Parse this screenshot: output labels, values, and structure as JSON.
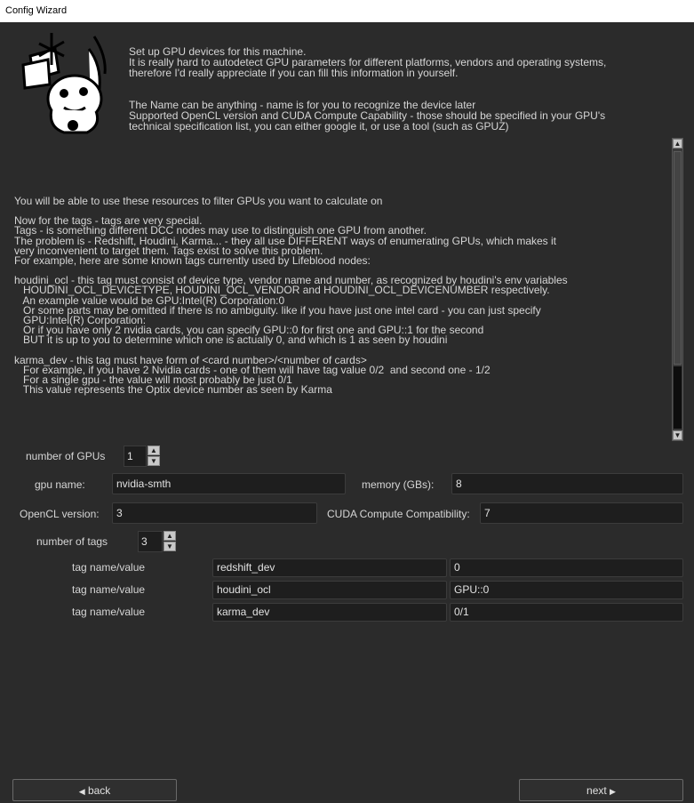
{
  "window": {
    "title": "Config Wizard"
  },
  "intro": [
    "Set up GPU devices for this machine.\nIt is really hard to autodetect GPU parameters for different platforms, vendors and operating systems,\ntherefore I'd really appreciate if you can fill this information in yourself.",
    "The Name can be anything - name is for you to recognize the device later\nSupported OpenCL version and CUDA Compute Capability - those should be specified in your GPU's\ntechnical specification list, you can either google it, or use a tool (such as GPUZ)"
  ],
  "help": [
    [
      "You will be able to use these resources to filter GPUs you want to calculate on"
    ],
    [
      "Now for the tags - tags are very special.",
      "Tags - is something different DCC nodes may use to distinguish one GPU from another.",
      "The problem is - Redshift, Houdini, Karma... - they all use DIFFERENT ways of enumerating GPUs, which makes it",
      "very inconvenient to target them. Tags exist to solve this problem.",
      "For example, here are some known tags currently used by Lifeblood nodes:"
    ],
    [
      "houdini_ocl - this tag must consist of device type, vendor name and number, as recognized by houdini's env variables",
      "   HOUDINI_OCL_DEVICETYPE, HOUDINI_OCL_VENDOR and HOUDINI_OCL_DEVICENUMBER respectively.",
      "   An example value would be GPU:Intel(R) Corporation:0",
      "   Or some parts may be omitted if there is no ambiguity. like if you have just one intel card - you can just specify",
      "   GPU:Intel(R) Corporation:",
      "   Or if you have only 2 nvidia cards, you can specify GPU::0 for first one and GPU::1 for the second",
      "   BUT it is up to you to determine which one is actually 0, and which is 1 as seen by houdini"
    ],
    [
      "karma_dev - this tag must have form of <card number>/<number of cards>",
      "   For example, if you have 2 Nvidia cards - one of them will have tag value 0/2  and second one - 1/2",
      "   For a single gpu - the value will most probably be just 0/1",
      "   This value represents the Optix device number as seen by Karma"
    ]
  ],
  "form": {
    "num_gpus_label": "number of GPUs",
    "num_gpus_value": "1",
    "gpu_name_label": "gpu name:",
    "gpu_name_value": "nvidia-smth",
    "memory_label": "memory (GBs):",
    "memory_value": "8",
    "opencl_label": "OpenCL version:",
    "opencl_value": "3",
    "cuda_label": "CUDA Compute Compatibility:",
    "cuda_value": "7",
    "num_tags_label": "number of tags",
    "num_tags_value": "3",
    "tags": [
      {
        "label": "tag name/value",
        "name": "redshift_dev",
        "value": "0"
      },
      {
        "label": "tag name/value",
        "name": "houdini_ocl",
        "value": "GPU::0"
      },
      {
        "label": "tag name/value",
        "name": "karma_dev",
        "value": "0/1"
      }
    ]
  },
  "nav": {
    "back_label": "back",
    "next_label": "next"
  },
  "icons": {
    "scroll_up": "▲",
    "scroll_down": "▼",
    "spin_up": "▲",
    "spin_down": "▼",
    "back_arrow": "◀",
    "next_arrow": "▶"
  }
}
